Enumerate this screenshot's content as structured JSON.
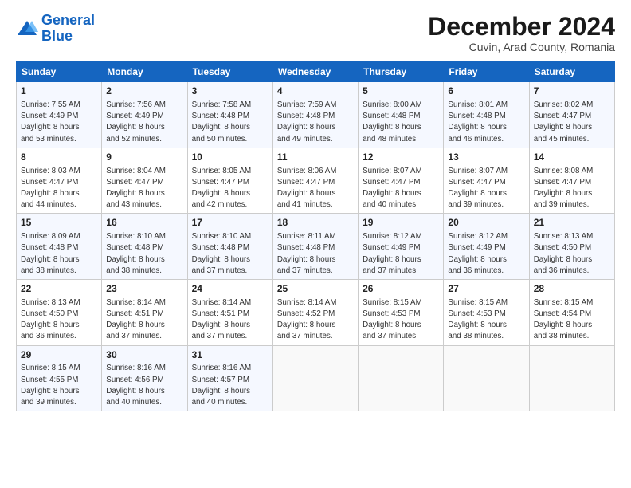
{
  "header": {
    "logo_line1": "General",
    "logo_line2": "Blue",
    "title": "December 2024",
    "subtitle": "Cuvin, Arad County, Romania"
  },
  "columns": [
    "Sunday",
    "Monday",
    "Tuesday",
    "Wednesday",
    "Thursday",
    "Friday",
    "Saturday"
  ],
  "weeks": [
    [
      {
        "day": "1",
        "lines": [
          "Sunrise: 7:55 AM",
          "Sunset: 4:49 PM",
          "Daylight: 8 hours",
          "and 53 minutes."
        ]
      },
      {
        "day": "2",
        "lines": [
          "Sunrise: 7:56 AM",
          "Sunset: 4:49 PM",
          "Daylight: 8 hours",
          "and 52 minutes."
        ]
      },
      {
        "day": "3",
        "lines": [
          "Sunrise: 7:58 AM",
          "Sunset: 4:48 PM",
          "Daylight: 8 hours",
          "and 50 minutes."
        ]
      },
      {
        "day": "4",
        "lines": [
          "Sunrise: 7:59 AM",
          "Sunset: 4:48 PM",
          "Daylight: 8 hours",
          "and 49 minutes."
        ]
      },
      {
        "day": "5",
        "lines": [
          "Sunrise: 8:00 AM",
          "Sunset: 4:48 PM",
          "Daylight: 8 hours",
          "and 48 minutes."
        ]
      },
      {
        "day": "6",
        "lines": [
          "Sunrise: 8:01 AM",
          "Sunset: 4:48 PM",
          "Daylight: 8 hours",
          "and 46 minutes."
        ]
      },
      {
        "day": "7",
        "lines": [
          "Sunrise: 8:02 AM",
          "Sunset: 4:47 PM",
          "Daylight: 8 hours",
          "and 45 minutes."
        ]
      }
    ],
    [
      {
        "day": "8",
        "lines": [
          "Sunrise: 8:03 AM",
          "Sunset: 4:47 PM",
          "Daylight: 8 hours",
          "and 44 minutes."
        ]
      },
      {
        "day": "9",
        "lines": [
          "Sunrise: 8:04 AM",
          "Sunset: 4:47 PM",
          "Daylight: 8 hours",
          "and 43 minutes."
        ]
      },
      {
        "day": "10",
        "lines": [
          "Sunrise: 8:05 AM",
          "Sunset: 4:47 PM",
          "Daylight: 8 hours",
          "and 42 minutes."
        ]
      },
      {
        "day": "11",
        "lines": [
          "Sunrise: 8:06 AM",
          "Sunset: 4:47 PM",
          "Daylight: 8 hours",
          "and 41 minutes."
        ]
      },
      {
        "day": "12",
        "lines": [
          "Sunrise: 8:07 AM",
          "Sunset: 4:47 PM",
          "Daylight: 8 hours",
          "and 40 minutes."
        ]
      },
      {
        "day": "13",
        "lines": [
          "Sunrise: 8:07 AM",
          "Sunset: 4:47 PM",
          "Daylight: 8 hours",
          "and 39 minutes."
        ]
      },
      {
        "day": "14",
        "lines": [
          "Sunrise: 8:08 AM",
          "Sunset: 4:47 PM",
          "Daylight: 8 hours",
          "and 39 minutes."
        ]
      }
    ],
    [
      {
        "day": "15",
        "lines": [
          "Sunrise: 8:09 AM",
          "Sunset: 4:48 PM",
          "Daylight: 8 hours",
          "and 38 minutes."
        ]
      },
      {
        "day": "16",
        "lines": [
          "Sunrise: 8:10 AM",
          "Sunset: 4:48 PM",
          "Daylight: 8 hours",
          "and 38 minutes."
        ]
      },
      {
        "day": "17",
        "lines": [
          "Sunrise: 8:10 AM",
          "Sunset: 4:48 PM",
          "Daylight: 8 hours",
          "and 37 minutes."
        ]
      },
      {
        "day": "18",
        "lines": [
          "Sunrise: 8:11 AM",
          "Sunset: 4:48 PM",
          "Daylight: 8 hours",
          "and 37 minutes."
        ]
      },
      {
        "day": "19",
        "lines": [
          "Sunrise: 8:12 AM",
          "Sunset: 4:49 PM",
          "Daylight: 8 hours",
          "and 37 minutes."
        ]
      },
      {
        "day": "20",
        "lines": [
          "Sunrise: 8:12 AM",
          "Sunset: 4:49 PM",
          "Daylight: 8 hours",
          "and 36 minutes."
        ]
      },
      {
        "day": "21",
        "lines": [
          "Sunrise: 8:13 AM",
          "Sunset: 4:50 PM",
          "Daylight: 8 hours",
          "and 36 minutes."
        ]
      }
    ],
    [
      {
        "day": "22",
        "lines": [
          "Sunrise: 8:13 AM",
          "Sunset: 4:50 PM",
          "Daylight: 8 hours",
          "and 36 minutes."
        ]
      },
      {
        "day": "23",
        "lines": [
          "Sunrise: 8:14 AM",
          "Sunset: 4:51 PM",
          "Daylight: 8 hours",
          "and 37 minutes."
        ]
      },
      {
        "day": "24",
        "lines": [
          "Sunrise: 8:14 AM",
          "Sunset: 4:51 PM",
          "Daylight: 8 hours",
          "and 37 minutes."
        ]
      },
      {
        "day": "25",
        "lines": [
          "Sunrise: 8:14 AM",
          "Sunset: 4:52 PM",
          "Daylight: 8 hours",
          "and 37 minutes."
        ]
      },
      {
        "day": "26",
        "lines": [
          "Sunrise: 8:15 AM",
          "Sunset: 4:53 PM",
          "Daylight: 8 hours",
          "and 37 minutes."
        ]
      },
      {
        "day": "27",
        "lines": [
          "Sunrise: 8:15 AM",
          "Sunset: 4:53 PM",
          "Daylight: 8 hours",
          "and 38 minutes."
        ]
      },
      {
        "day": "28",
        "lines": [
          "Sunrise: 8:15 AM",
          "Sunset: 4:54 PM",
          "Daylight: 8 hours",
          "and 38 minutes."
        ]
      }
    ],
    [
      {
        "day": "29",
        "lines": [
          "Sunrise: 8:15 AM",
          "Sunset: 4:55 PM",
          "Daylight: 8 hours",
          "and 39 minutes."
        ]
      },
      {
        "day": "30",
        "lines": [
          "Sunrise: 8:16 AM",
          "Sunset: 4:56 PM",
          "Daylight: 8 hours",
          "and 40 minutes."
        ]
      },
      {
        "day": "31",
        "lines": [
          "Sunrise: 8:16 AM",
          "Sunset: 4:57 PM",
          "Daylight: 8 hours",
          "and 40 minutes."
        ]
      },
      {
        "day": "",
        "lines": []
      },
      {
        "day": "",
        "lines": []
      },
      {
        "day": "",
        "lines": []
      },
      {
        "day": "",
        "lines": []
      }
    ]
  ]
}
